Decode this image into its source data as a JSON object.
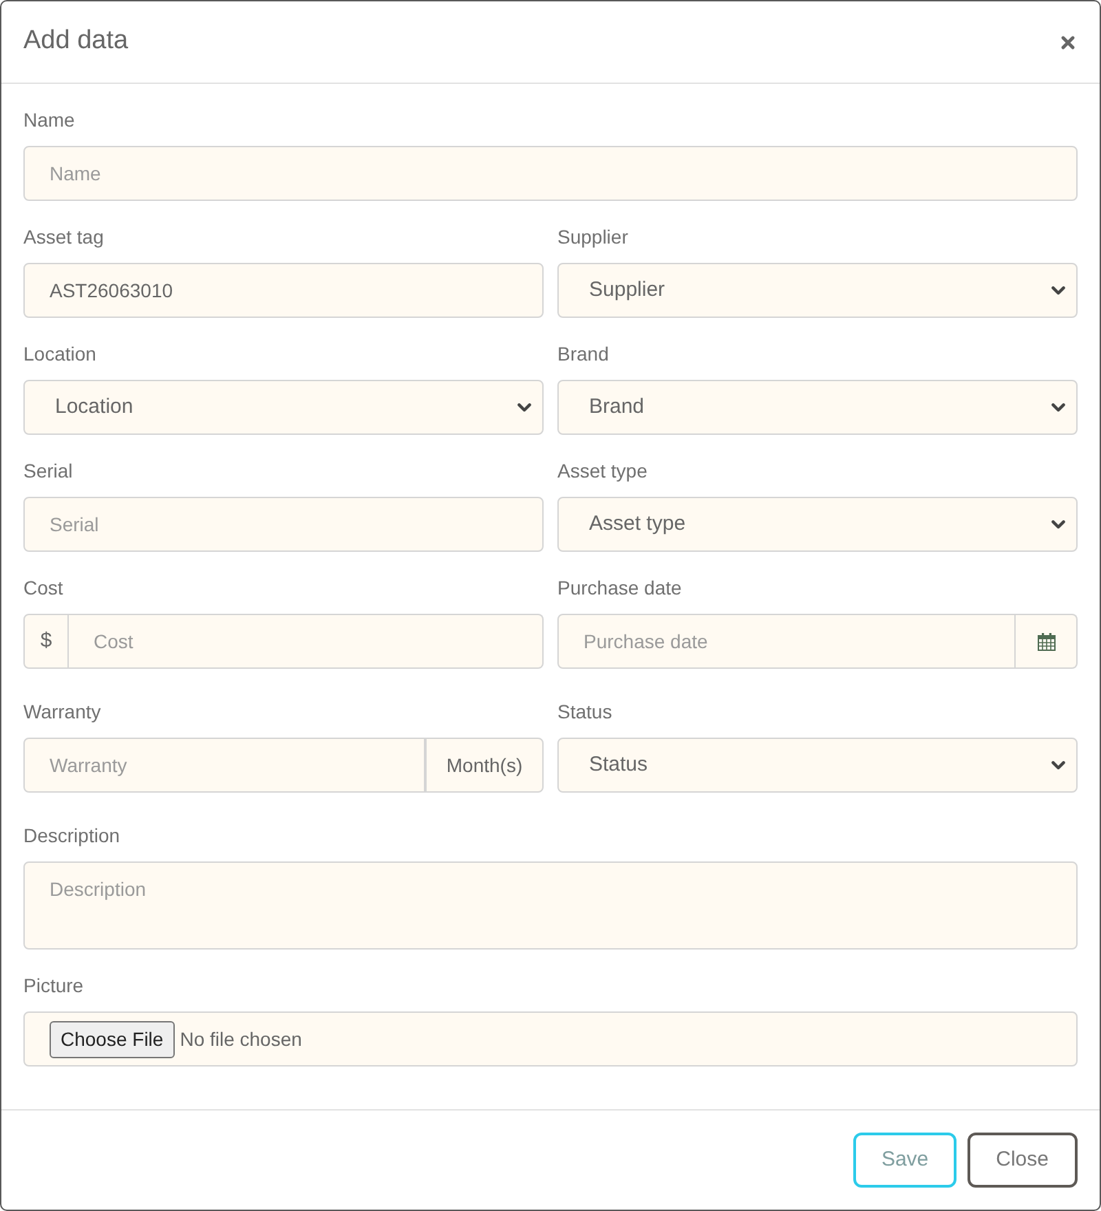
{
  "dialog": {
    "title": "Add data"
  },
  "rows": [
    [
      {
        "kind": "text",
        "label": "Name",
        "placeholder": "Name"
      }
    ],
    [
      {
        "kind": "text",
        "label": "Asset tag",
        "value": "AST26063010"
      },
      {
        "kind": "select",
        "label": "Supplier",
        "value": "Supplier"
      }
    ],
    [
      {
        "kind": "select",
        "label": "Location",
        "value": "Location"
      },
      {
        "kind": "select",
        "label": "Brand",
        "value": "Brand"
      }
    ],
    [
      {
        "kind": "text",
        "label": "Serial",
        "placeholder": "Serial"
      },
      {
        "kind": "select",
        "label": "Asset type",
        "value": "Asset type"
      }
    ],
    [
      {
        "kind": "prefixed",
        "label": "Cost",
        "prefix": "$",
        "placeholder": "Cost"
      },
      {
        "kind": "date",
        "label": "Purchase date",
        "placeholder": "Purchase date"
      }
    ],
    [
      {
        "kind": "suffixed",
        "label": "Warranty",
        "placeholder": "Warranty",
        "suffix": "Month(s)"
      },
      {
        "kind": "select",
        "label": "Status",
        "value": "Status"
      }
    ],
    [
      {
        "kind": "textarea",
        "label": "Description",
        "placeholder": "Description"
      }
    ],
    [
      {
        "kind": "file",
        "label": "Picture",
        "button": "Choose File",
        "file_status": "No file chosen"
      }
    ]
  ],
  "footer": {
    "buttons": [
      {
        "kind": "primary",
        "label": "Save"
      },
      {
        "kind": "secondary",
        "label": "Close"
      }
    ]
  }
}
